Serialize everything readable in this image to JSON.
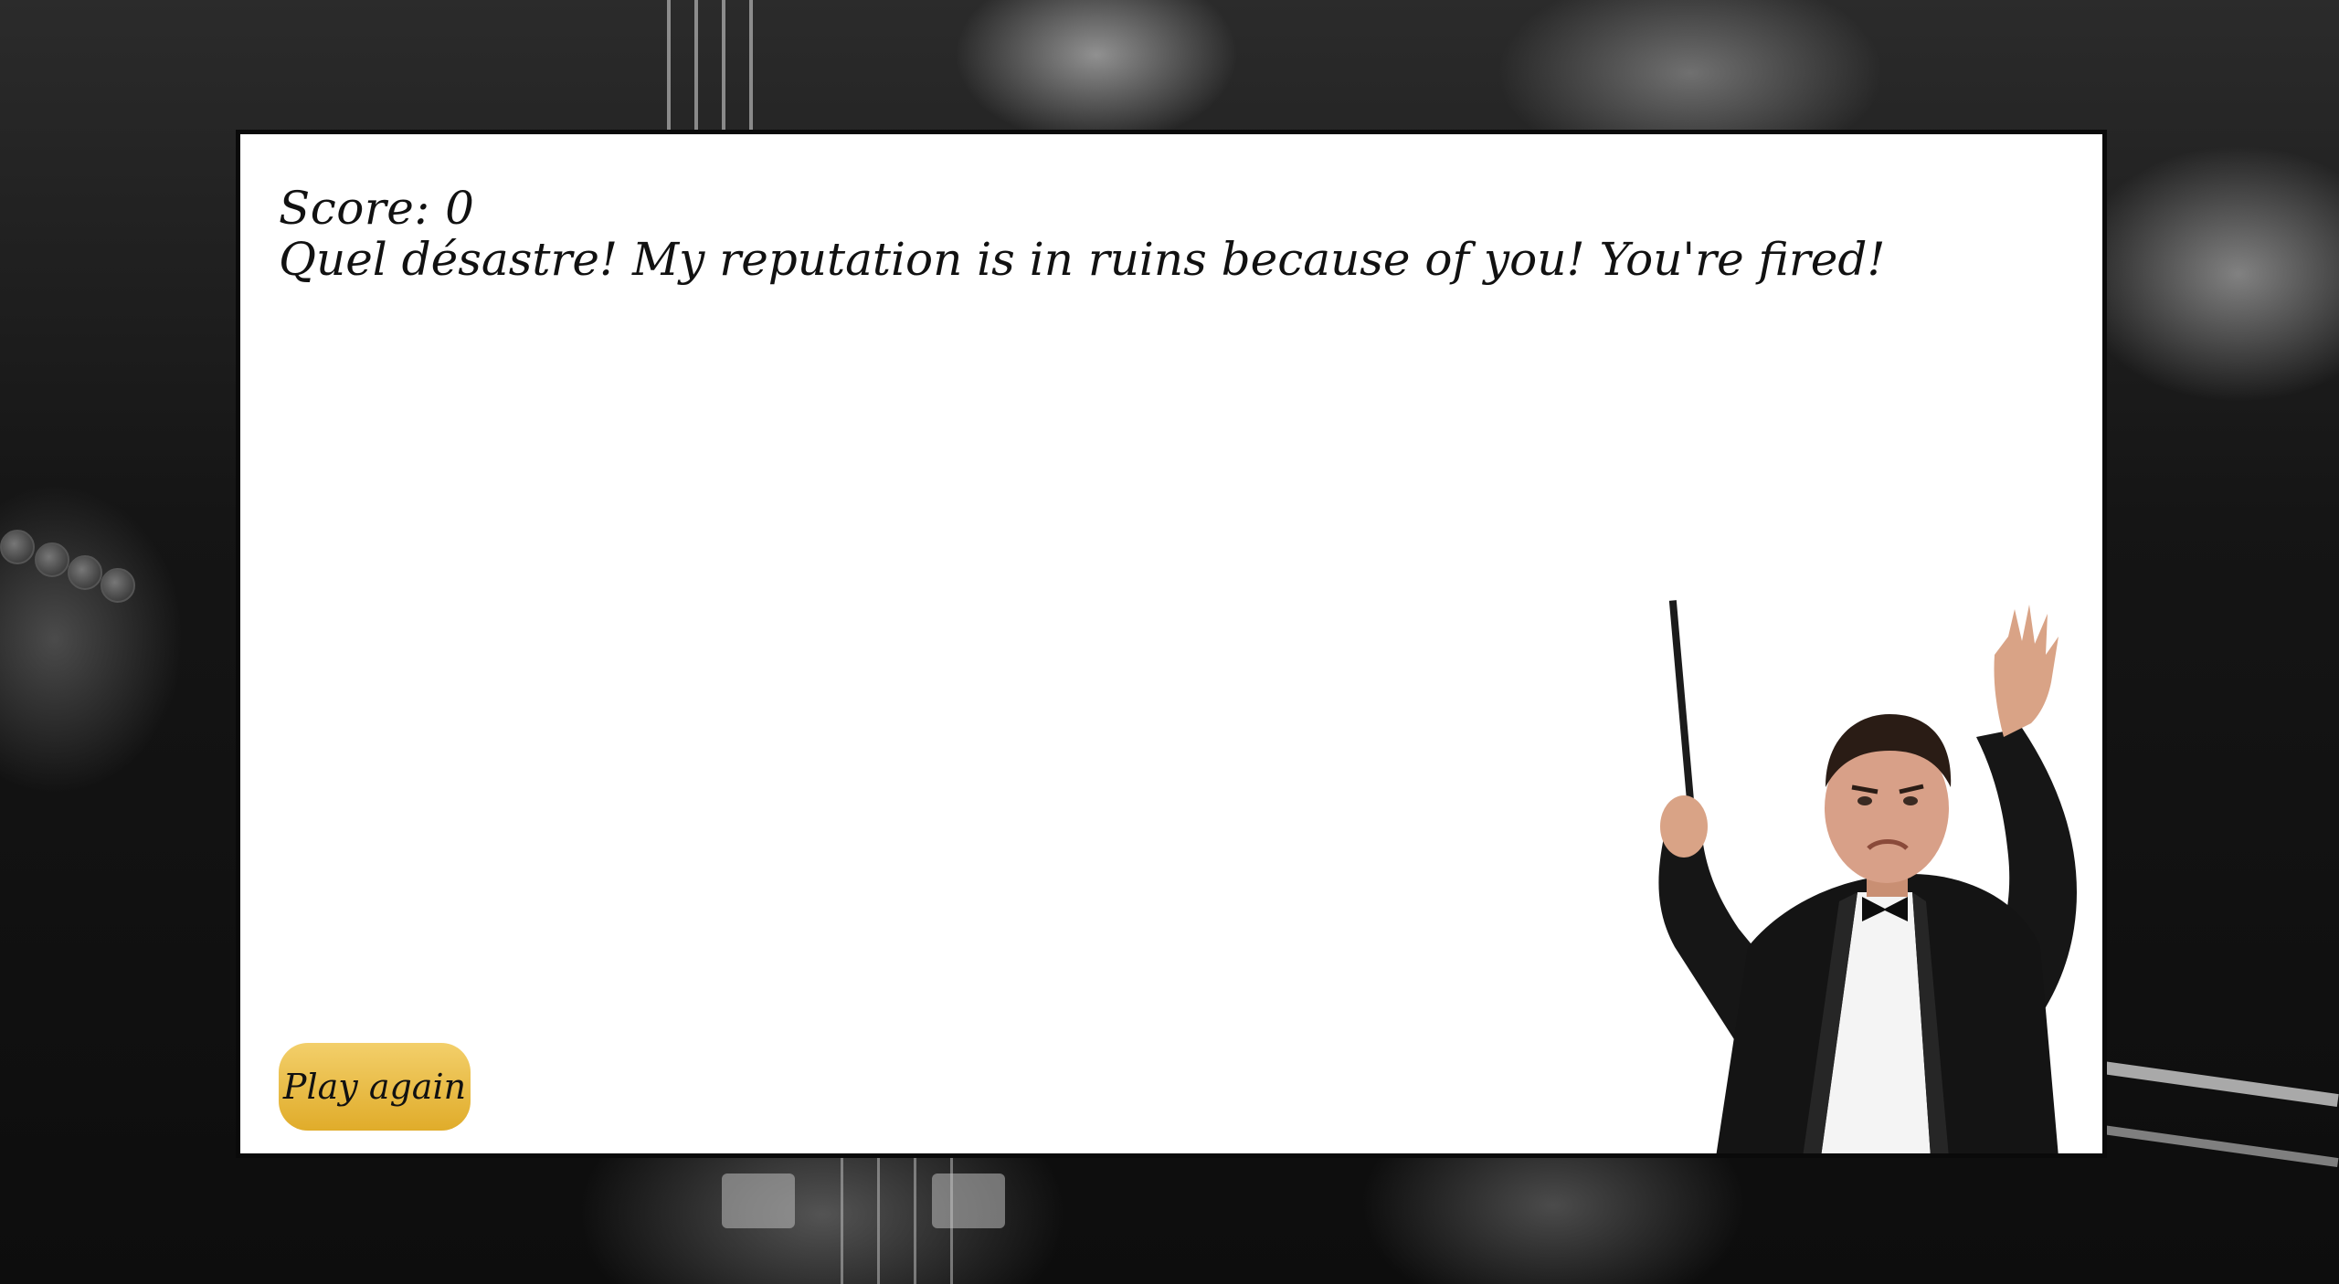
{
  "game": {
    "score_label": "Score:",
    "score_value": "0",
    "message": "Quel désastre! My reputation is in ruins because of you! You're fired!",
    "play_again_label": "Play again"
  },
  "colors": {
    "panel_background": "#ffffff",
    "panel_border": "#0a0a0a",
    "button_gold_top": "#f3cf6a",
    "button_gold_bottom": "#e0ac2a",
    "text": "#111111"
  },
  "icons": {
    "conductor": "conductor-figure"
  }
}
